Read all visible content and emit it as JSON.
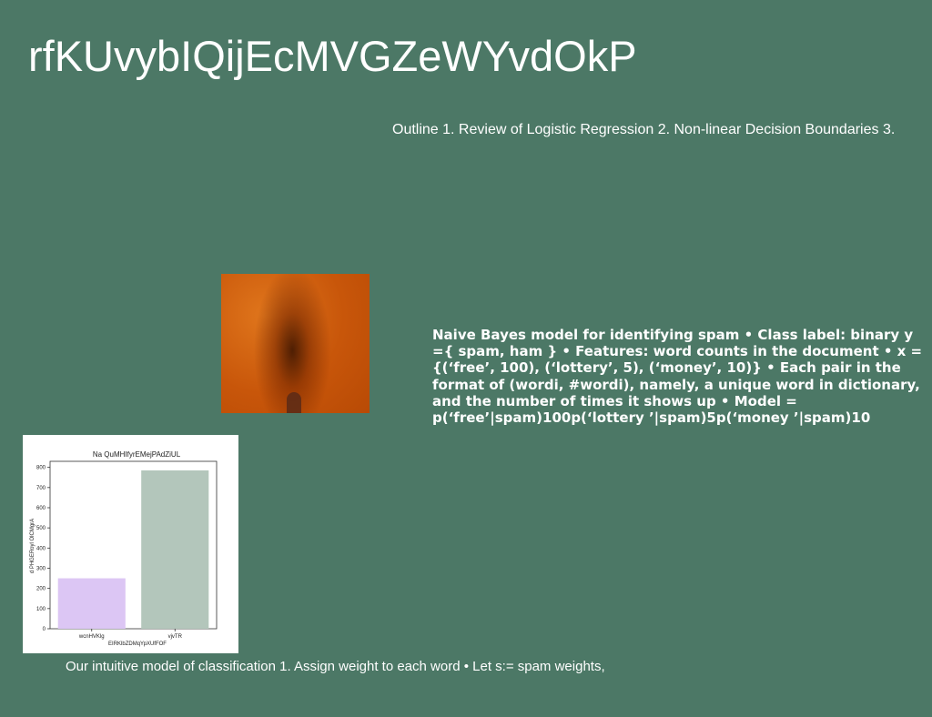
{
  "slide": {
    "title": "rfKUvybIQijEcMVGZeWYvdOkP",
    "outline": "Outline 1. Review of Logistic Regression 2. Non-linear Decision Boundaries 3.",
    "body_text": "Naive Bayes model for identifying spam • Class label: binary y ={ spam, ham } • Features: word counts in the document • x = {(‘free’, 100), (‘lottery’, 5), (‘money’, 10)} • Each pair in the format of (wordi, #wordi), namely, a unique word in dictionary, and the number of times it shows up • Model = p(‘free’|spam)100p(‘lottery ’|spam)5p(‘money ’|spam)10",
    "caption": "Our intuitive model of classification 1. Assign weight to each word • Let s:= spam weights,"
  },
  "colors": {
    "background": "#4c7866",
    "text": "#ffffff",
    "bar_1": "#dcc6f4",
    "bar_2": "#b3c6bb"
  },
  "chart_data": {
    "type": "bar",
    "title": "Na QuMHIfyrEMejPAdZiUL",
    "xlabel": "EIRKlbZDMqYpXUfFOF",
    "ylabel": "d PHGERoyl OlCMgrA",
    "categories": [
      "wcnHVKlg",
      "vjvTR"
    ],
    "values": [
      250,
      785
    ],
    "ylim": [
      0,
      830
    ],
    "yticks": [
      0,
      100,
      200,
      300,
      400,
      500,
      600,
      700,
      800
    ],
    "grid": false
  }
}
